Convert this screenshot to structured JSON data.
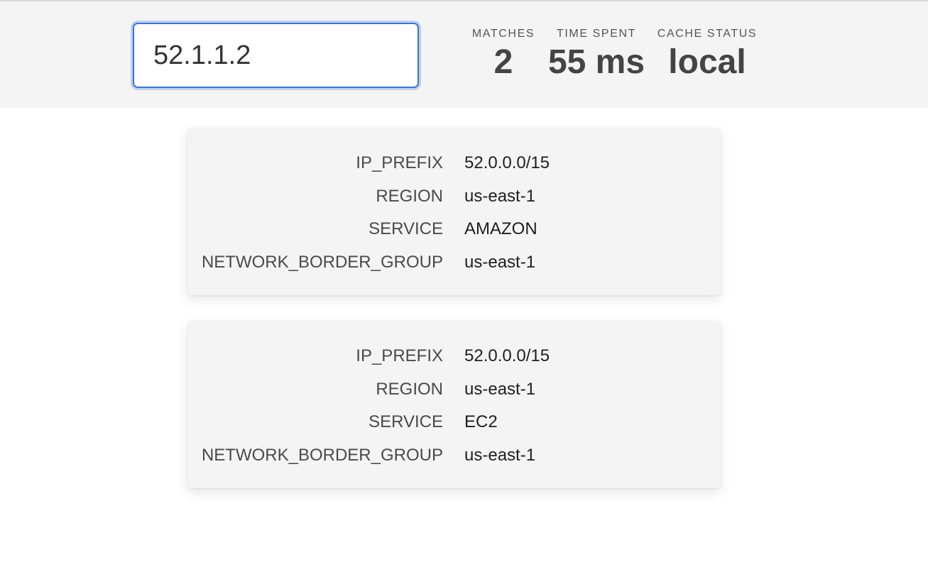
{
  "search": {
    "value": "52.1.1.2"
  },
  "stats": {
    "matches_label": "MATCHES",
    "matches_value": "2",
    "time_label": "TIME SPENT",
    "time_value": "55 ms",
    "cache_label": "CACHE STATUS",
    "cache_value": "local"
  },
  "results": [
    {
      "fields": [
        {
          "key": "IP_PREFIX",
          "value": "52.0.0.0/15"
        },
        {
          "key": "REGION",
          "value": "us-east-1"
        },
        {
          "key": "SERVICE",
          "value": "AMAZON"
        },
        {
          "key": "NETWORK_BORDER_GROUP",
          "value": "us-east-1"
        }
      ]
    },
    {
      "fields": [
        {
          "key": "IP_PREFIX",
          "value": "52.0.0.0/15"
        },
        {
          "key": "REGION",
          "value": "us-east-1"
        },
        {
          "key": "SERVICE",
          "value": "EC2"
        },
        {
          "key": "NETWORK_BORDER_GROUP",
          "value": "us-east-1"
        }
      ]
    }
  ],
  "colors": {
    "header_background": "#f4f4f4",
    "input_focus_border": "#3b73d9",
    "card_background": "#f4f4f4"
  }
}
